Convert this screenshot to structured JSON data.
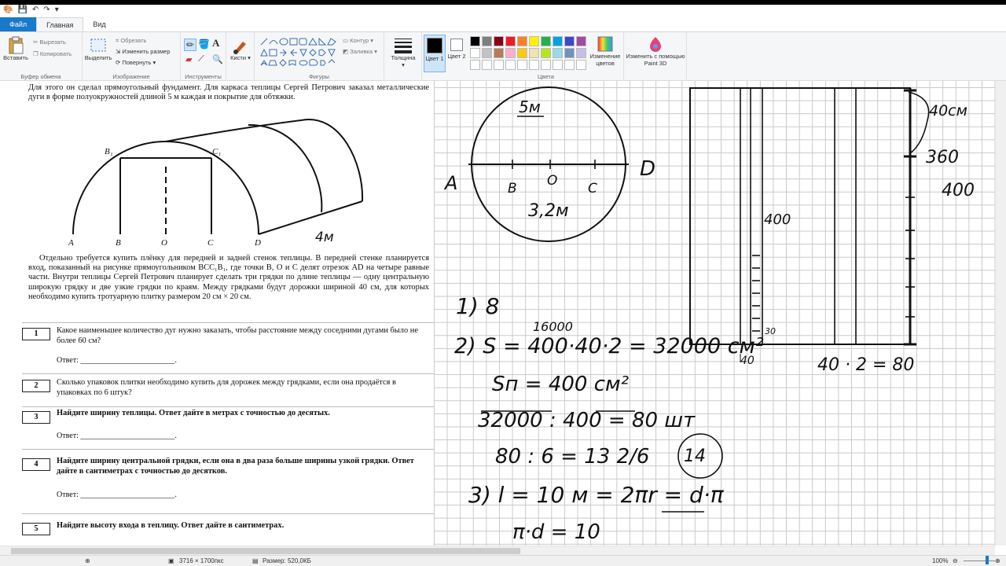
{
  "tabs": {
    "file": "Файл",
    "home": "Главная",
    "view": "Вид"
  },
  "ribbon": {
    "clipboard": {
      "paste": "Вставить",
      "cut": "Вырезать",
      "copy": "Копировать",
      "caption": "Буфер обмена"
    },
    "image": {
      "select": "Выделить",
      "crop": "Обрезать",
      "resize": "Изменить размер",
      "rotate": "Повернуть",
      "caption": "Изображение"
    },
    "tools": {
      "caption": "Инструменты",
      "text_glyph": "A"
    },
    "brushes": {
      "label": "Кисти"
    },
    "shapes": {
      "outline": "Контур",
      "fill": "Заливка",
      "caption": "Фигуры"
    },
    "size": {
      "label": "Толщина"
    },
    "color1": {
      "label": "Цвет 1"
    },
    "color2": {
      "label": "Цвет 2"
    },
    "colors": {
      "caption": "Цвета",
      "edit": "Изменение цветов"
    },
    "paint3d": {
      "label": "Изменить с помощью Paint 3D"
    }
  },
  "palette": [
    "#000000",
    "#7f7f7f",
    "#880015",
    "#ed1c24",
    "#ff7f27",
    "#fff200",
    "#22b14c",
    "#00a2e8",
    "#3f48cc",
    "#a349a4",
    "#ffffff",
    "#c3c3c3",
    "#b97a57",
    "#ffaec9",
    "#ffc90e",
    "#efe4b0",
    "#b5e61d",
    "#99d9ea",
    "#7092be",
    "#c8bfe7",
    "#ffffff",
    "#ffffff",
    "#ffffff",
    "#ffffff",
    "#ffffff",
    "#ffffff",
    "#ffffff",
    "#ffffff",
    "#ffffff",
    "#ffffff"
  ],
  "document": {
    "intro": "Для этого он сделал прямоугольный фундамент. Для каркаса теплицы Сергей Петрович заказал металлические дуги в форме полуокружностей длиной 5 м каждая и покрытие для обтяжки.",
    "figure_labels": {
      "A": "A",
      "B": "B",
      "O": "O",
      "C": "C",
      "D": "D",
      "B1": "B₁",
      "C1": "C₁",
      "note": "4м"
    },
    "body": "Отдельно требуется купить плёнку для передней и задней стенок теплицы. В передней стенке планируется вход, показанный на рисунке прямоугольником BCC₁B₁, где точки B, O и C делят отрезок AD на четыре равные части. Внутри теплицы Сергей Петрович планирует сделать три грядки по длине теплицы — одну центральную широкую грядку и две узкие грядки по краям. Между грядками будут дорожки шириной 40 см, для которых необходимо купить тротуарную плитку размером 20 см × 20 см.",
    "answer_label": "Ответ: ________________________.",
    "questions": [
      {
        "num": "1",
        "text": "Какое наименьшее количество дуг нужно заказать, чтобы расстояние между соседними дугами было не более 60 см?"
      },
      {
        "num": "2",
        "text": "Сколько упаковок плитки необходимо купить для дорожек между грядками, если она продаётся в упаковках по 6 штук?"
      },
      {
        "num": "3",
        "text": "Найдите ширину теплицы. Ответ дайте в метрах с точностью до десятых."
      },
      {
        "num": "4",
        "text": "Найдите ширину центральной грядки, если она в два раза больше ширины узкой грядки. Ответ дайте в сантиметрах с точностью до десятков."
      },
      {
        "num": "5",
        "text": "Найдите высоту входа в теплицу. Ответ дайте в сантиметрах."
      }
    ]
  },
  "handwriting": {
    "circle_top": "5м",
    "A": "A",
    "D": "D",
    "B": "B",
    "O": "O",
    "C": "C",
    "diam": "3,2м",
    "l1": "1)  8",
    "l1600": "16000",
    "l2": "2)  S = 400·40·2 = 32000 см²",
    "sn": "Sп = 400 см²",
    "div": "32000 : 400 = 80 шт",
    "frac": "80 : 6 = 13 2/6",
    "circled": "14",
    "l3": "3)  l = 10 м = 2πr = d·π",
    "pid": "π·d = 10",
    "r40": "40см",
    "r360": "360",
    "r400": "400",
    "in400": "400",
    "in30": "30",
    "b40": "40",
    "b80": "40 · 2 = 80"
  },
  "status": {
    "dimensions": "3716 × 1700пкс",
    "size": "Размер: 520,0КБ",
    "zoom": "100%"
  }
}
